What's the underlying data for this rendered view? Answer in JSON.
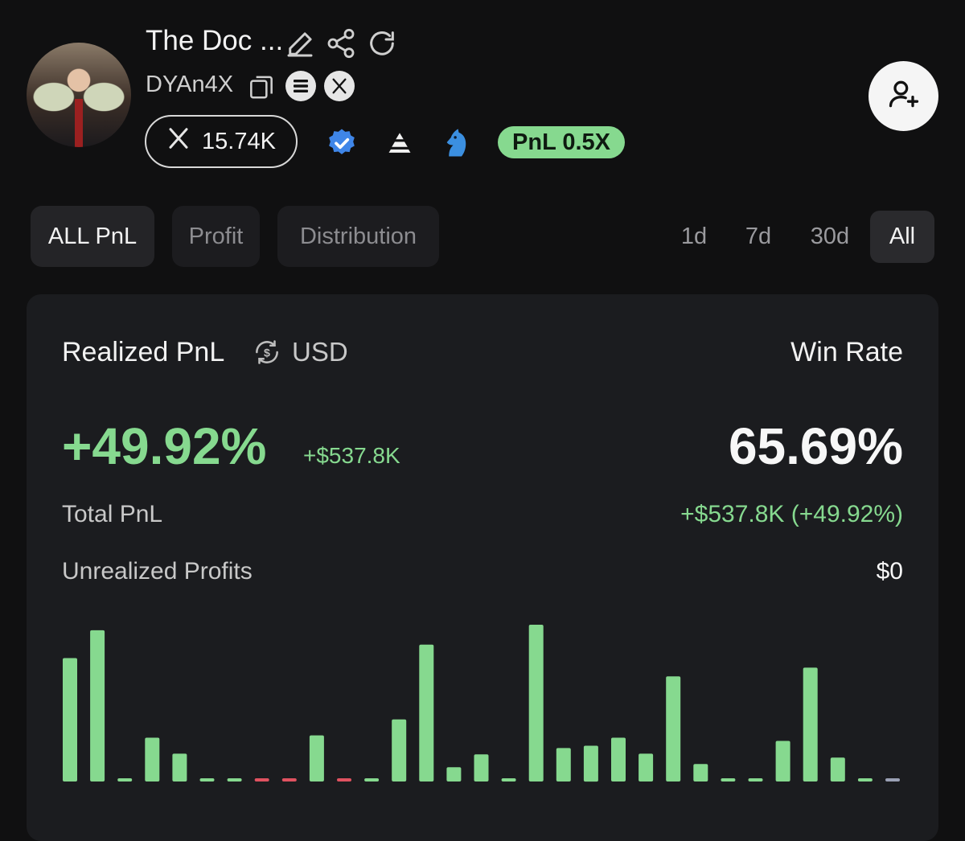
{
  "profile": {
    "name": "The Doc ...",
    "handle": "DYAn4X",
    "x_followers": "15.74K",
    "pnl_badge": "PnL 0.5X"
  },
  "tabs": [
    {
      "label": "ALL PnL",
      "active": true
    },
    {
      "label": "Profit",
      "active": false
    },
    {
      "label": "Distribution",
      "active": false
    }
  ],
  "ranges": [
    {
      "label": "1d",
      "active": false
    },
    {
      "label": "7d",
      "active": false
    },
    {
      "label": "30d",
      "active": false
    },
    {
      "label": "All",
      "active": true
    }
  ],
  "stats": {
    "realized_label": "Realized PnL",
    "currency": "USD",
    "realized_pct": "+49.92%",
    "realized_usd": "+$537.8K",
    "win_rate_label": "Win Rate",
    "win_rate": "65.69%",
    "total_pnl_label": "Total PnL",
    "total_pnl_value": "+$537.8K (+49.92%)",
    "unrealized_label": "Unrealized Profits",
    "unrealized_value": "$0"
  },
  "colors": {
    "positive": "#86d98f",
    "negative": "#e05260",
    "neutral": "#9aa0b4",
    "card": "#1b1c1f",
    "background": "#101011"
  },
  "chart_data": {
    "type": "bar",
    "values": [
      155,
      190,
      3,
      55,
      35,
      3,
      3,
      -3,
      -3,
      58,
      -3,
      3,
      78,
      172,
      18,
      34,
      3,
      197,
      42,
      45,
      55,
      35,
      132,
      22,
      3,
      3,
      51,
      143,
      30,
      3,
      0
    ],
    "ylim": [
      -5,
      200
    ],
    "grid": false
  }
}
